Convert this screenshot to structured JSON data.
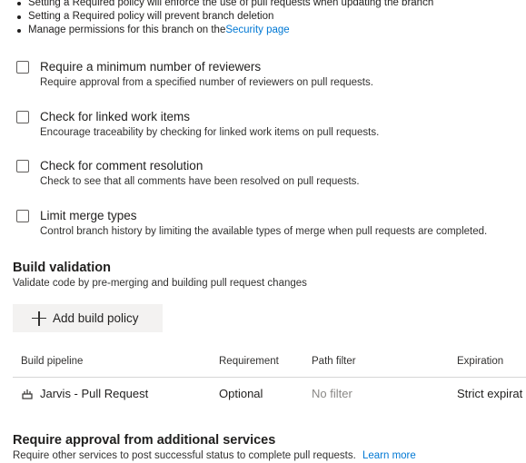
{
  "notes": [
    {
      "text": "Setting a Required policy will enforce the use of pull requests when updating the branch"
    },
    {
      "text": "Setting a Required policy will prevent branch deletion"
    },
    {
      "text": "Manage permissions for this branch on the ",
      "link": "Security page"
    }
  ],
  "policies": [
    {
      "title": "Require a minimum number of reviewers",
      "description": "Require approval from a specified number of reviewers on pull requests."
    },
    {
      "title": "Check for linked work items",
      "description": "Encourage traceability by checking for linked work items on pull requests."
    },
    {
      "title": "Check for comment resolution",
      "description": "Check to see that all comments have been resolved on pull requests."
    },
    {
      "title": "Limit merge types",
      "description": "Control branch history by limiting the available types of merge when pull requests are completed."
    }
  ],
  "build_validation": {
    "title": "Build validation",
    "description": "Validate code by pre-merging and building pull request changes",
    "add_button": "Add build policy",
    "columns": {
      "pipeline": "Build pipeline",
      "requirement": "Requirement",
      "path_filter": "Path filter",
      "expiration": "Expiration"
    },
    "row": {
      "pipeline": "Jarvis - Pull Request",
      "requirement": "Optional",
      "path_filter": "No filter",
      "expiration": "Strict expirat"
    }
  },
  "additional_services": {
    "title": "Require approval from additional services",
    "description": "Require other services to post successful status to complete pull requests.",
    "link": "Learn more"
  },
  "colors": {
    "link": "#0078d4",
    "text": "#201f1e",
    "button_bg": "#f3f2f1",
    "muted": "#8a8886"
  },
  "icons": {
    "add": "plus-icon",
    "pipeline": "build-pipeline-icon"
  }
}
